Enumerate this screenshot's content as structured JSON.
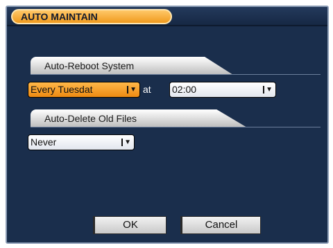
{
  "window": {
    "title": "AUTO MAINTAIN"
  },
  "reboot": {
    "section_label": "Auto-Reboot System",
    "day_value": "Every Tuesdat",
    "at_label": "at",
    "time_value": "02:00"
  },
  "delete": {
    "section_label": "Auto-Delete Old Files",
    "value": "Never"
  },
  "buttons": {
    "ok": "OK",
    "cancel": "Cancel"
  },
  "colors": {
    "background": "#1a2e4c",
    "accent": "#f09a1e"
  }
}
